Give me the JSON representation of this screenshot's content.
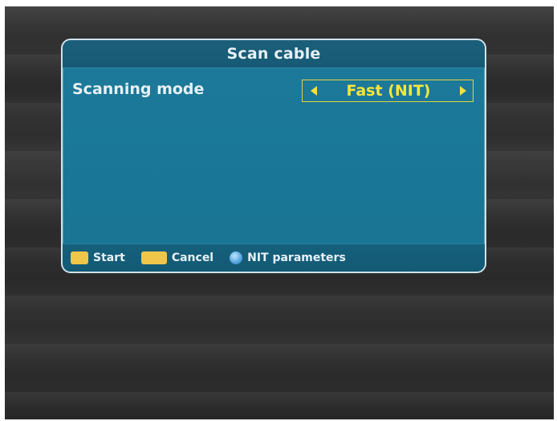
{
  "dialog": {
    "title": "Scan cable",
    "setting": {
      "label": "Scanning mode",
      "value": "Fast (NIT)"
    }
  },
  "footer": {
    "hints": [
      {
        "key": "ok-key",
        "label": "Start"
      },
      {
        "key": "exit-key",
        "label": "Cancel"
      },
      {
        "key": "blue-key",
        "label": "NIT parameters"
      }
    ]
  },
  "colors": {
    "panel": "#1a7797",
    "title_bar": "#165a75",
    "selector": "#f4e23a",
    "ok_key": "#f0c64a",
    "blue_key": "#5aa8e0"
  }
}
